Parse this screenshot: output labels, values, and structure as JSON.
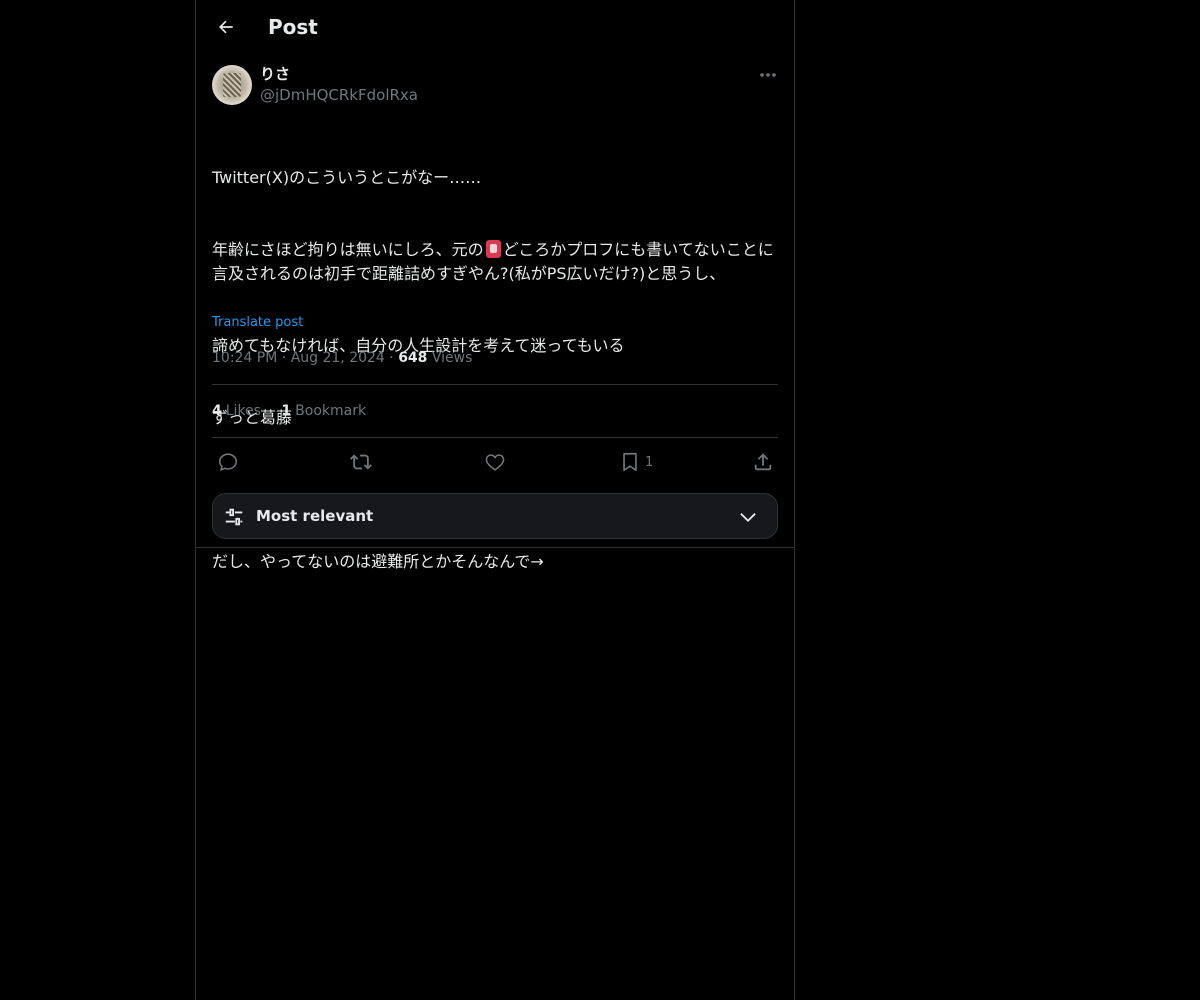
{
  "header": {
    "back_icon": "arrow-left-icon",
    "title": "Post"
  },
  "author": {
    "display_name": "りさ",
    "handle": "@jDmHQCRkFdolRxa",
    "more_icon": "more-horizontal-icon"
  },
  "post": {
    "lines": [
      "Twitter(X)のこういうとこがなー……",
      "年齢にさほど拘りは無いにしろ、元の",
      "どころかプロフにも書いてないことに言及されるのは初手で距離詰めすぎやん?(私がPS広いだけ?)と思うし、",
      "諦めてもなければ、自分の人生設計を考えて迷ってもいる",
      "ずっと葛藤",
      "",
      "だし、やってないのは避難所とかそんなんで→"
    ],
    "translate_label": "Translate post"
  },
  "meta": {
    "time": "10:24 PM",
    "separator": "·",
    "date": "Aug 21, 2024",
    "views_count": "648",
    "views_label": "Views"
  },
  "stats": {
    "likes_count": "4",
    "likes_label": "Likes",
    "bookmarks_count": "1",
    "bookmarks_label": "Bookmark"
  },
  "actions": {
    "reply_icon": "reply-icon",
    "repost_icon": "repost-icon",
    "like_icon": "heart-icon",
    "bookmark_icon": "bookmark-icon",
    "bookmark_count": "1",
    "share_icon": "share-icon"
  },
  "sort": {
    "label": "Most relevant",
    "icon": "sliders-icon",
    "chevron": "chevron-down-icon"
  },
  "colors": {
    "background": "#000000",
    "text": "#e7e9ea",
    "muted": "#71767b",
    "link": "#1d9bf0",
    "border": "#2f3336"
  }
}
